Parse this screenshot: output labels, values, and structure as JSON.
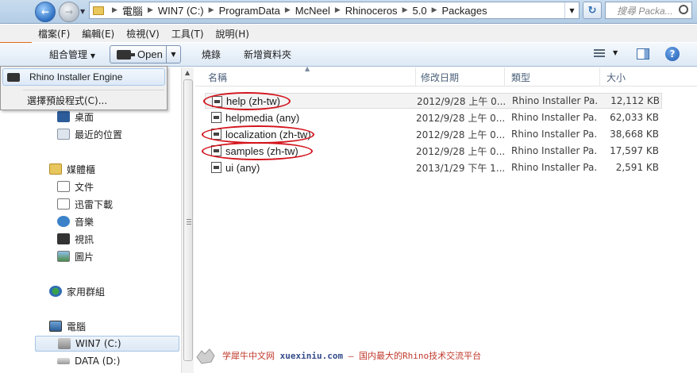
{
  "address_bar": {
    "crumbs": [
      "電腦",
      "WIN7 (C:)",
      "ProgramData",
      "McNeel",
      "Rhinoceros",
      "5.0",
      "Packages"
    ]
  },
  "search": {
    "placeholder": "搜尋 Packa..."
  },
  "menubar": {
    "items": [
      "檔案(F)",
      "編輯(E)",
      "檢視(V)",
      "工具(T)",
      "說明(H)"
    ]
  },
  "toolbar": {
    "organize": "組合管理",
    "open": "Open",
    "burn": "燒錄",
    "new_folder": "新增資料夾"
  },
  "open_menu": {
    "items": [
      "Rhino Installer Engine",
      "選擇預設程式(C)..."
    ]
  },
  "nav": {
    "desktop": "桌面",
    "recent": "最近的位置",
    "libraries": "媒體櫃",
    "documents": "文件",
    "thunder": "迅雷下載",
    "music": "音樂",
    "videos": "視訊",
    "pictures": "圖片",
    "homegroup": "家用群組",
    "computer": "電腦",
    "drive_c": "WIN7 (C:)",
    "drive_d": "DATA (D:)"
  },
  "columns": {
    "name": "名稱",
    "date": "修改日期",
    "type": "類型",
    "size": "大小"
  },
  "files": [
    {
      "name": "help (zh-tw)",
      "date": "2012/9/28 上午 0...",
      "type": "Rhino Installer Pa...",
      "size": "12,112 KB"
    },
    {
      "name": "helpmedia (any)",
      "date": "2012/9/28 上午 0...",
      "type": "Rhino Installer Pa...",
      "size": "62,033 KB"
    },
    {
      "name": "localization (zh-tw)",
      "date": "2012/9/28 上午 0...",
      "type": "Rhino Installer Pa...",
      "size": "38,668 KB"
    },
    {
      "name": "samples (zh-tw)",
      "date": "2012/9/28 上午 0...",
      "type": "Rhino Installer Pa...",
      "size": "17,597 KB"
    },
    {
      "name": "ui (any)",
      "date": "2013/1/29 下午 1...",
      "type": "Rhino Installer Pa...",
      "size": "2,591 KB"
    }
  ],
  "watermark": {
    "site_cn": "学犀牛中文网",
    "site_url": "xuexiniu.com",
    "slogan": "— 国内最大的Rhino技术交流平台"
  },
  "colors": {
    "accent": "#2d6fc2",
    "annotation": "#d3121b",
    "selection": "#dce8f5"
  }
}
